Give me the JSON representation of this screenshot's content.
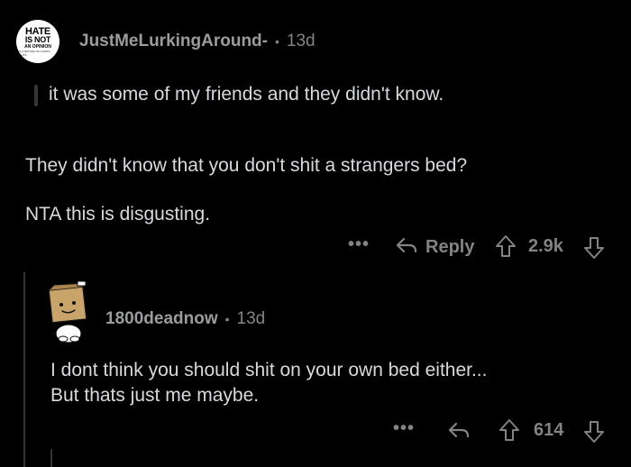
{
  "comment1": {
    "avatar": {
      "line1": "HATE",
      "line2": "IS NOT",
      "line3": "AN OPINION",
      "line4": "IT'S A MATTER OF HUMAN RIGHTS"
    },
    "username": "JustMeLurkingAround-",
    "separator": "•",
    "age": "13d",
    "quote": "it was some of my friends and they didn't know.",
    "paragraph1": "They didn't know that you don't shit a strangers bed?",
    "paragraph2": "NTA this is disgusting.",
    "more_label": "•••",
    "reply_label": "Reply",
    "score": "2.9k"
  },
  "comment2": {
    "avatar_icon": "cardboard-box-avatar-icon",
    "username": "1800deadnow",
    "separator": "•",
    "age": "13d",
    "line1": "I dont think you should shit on your own bed either...",
    "line2": "But thats just me maybe.",
    "more_label": "•••",
    "score": "614"
  },
  "colors": {
    "background": "#000000",
    "text": "#d7dadc",
    "muted": "#818384",
    "thread_line": "#343536"
  }
}
